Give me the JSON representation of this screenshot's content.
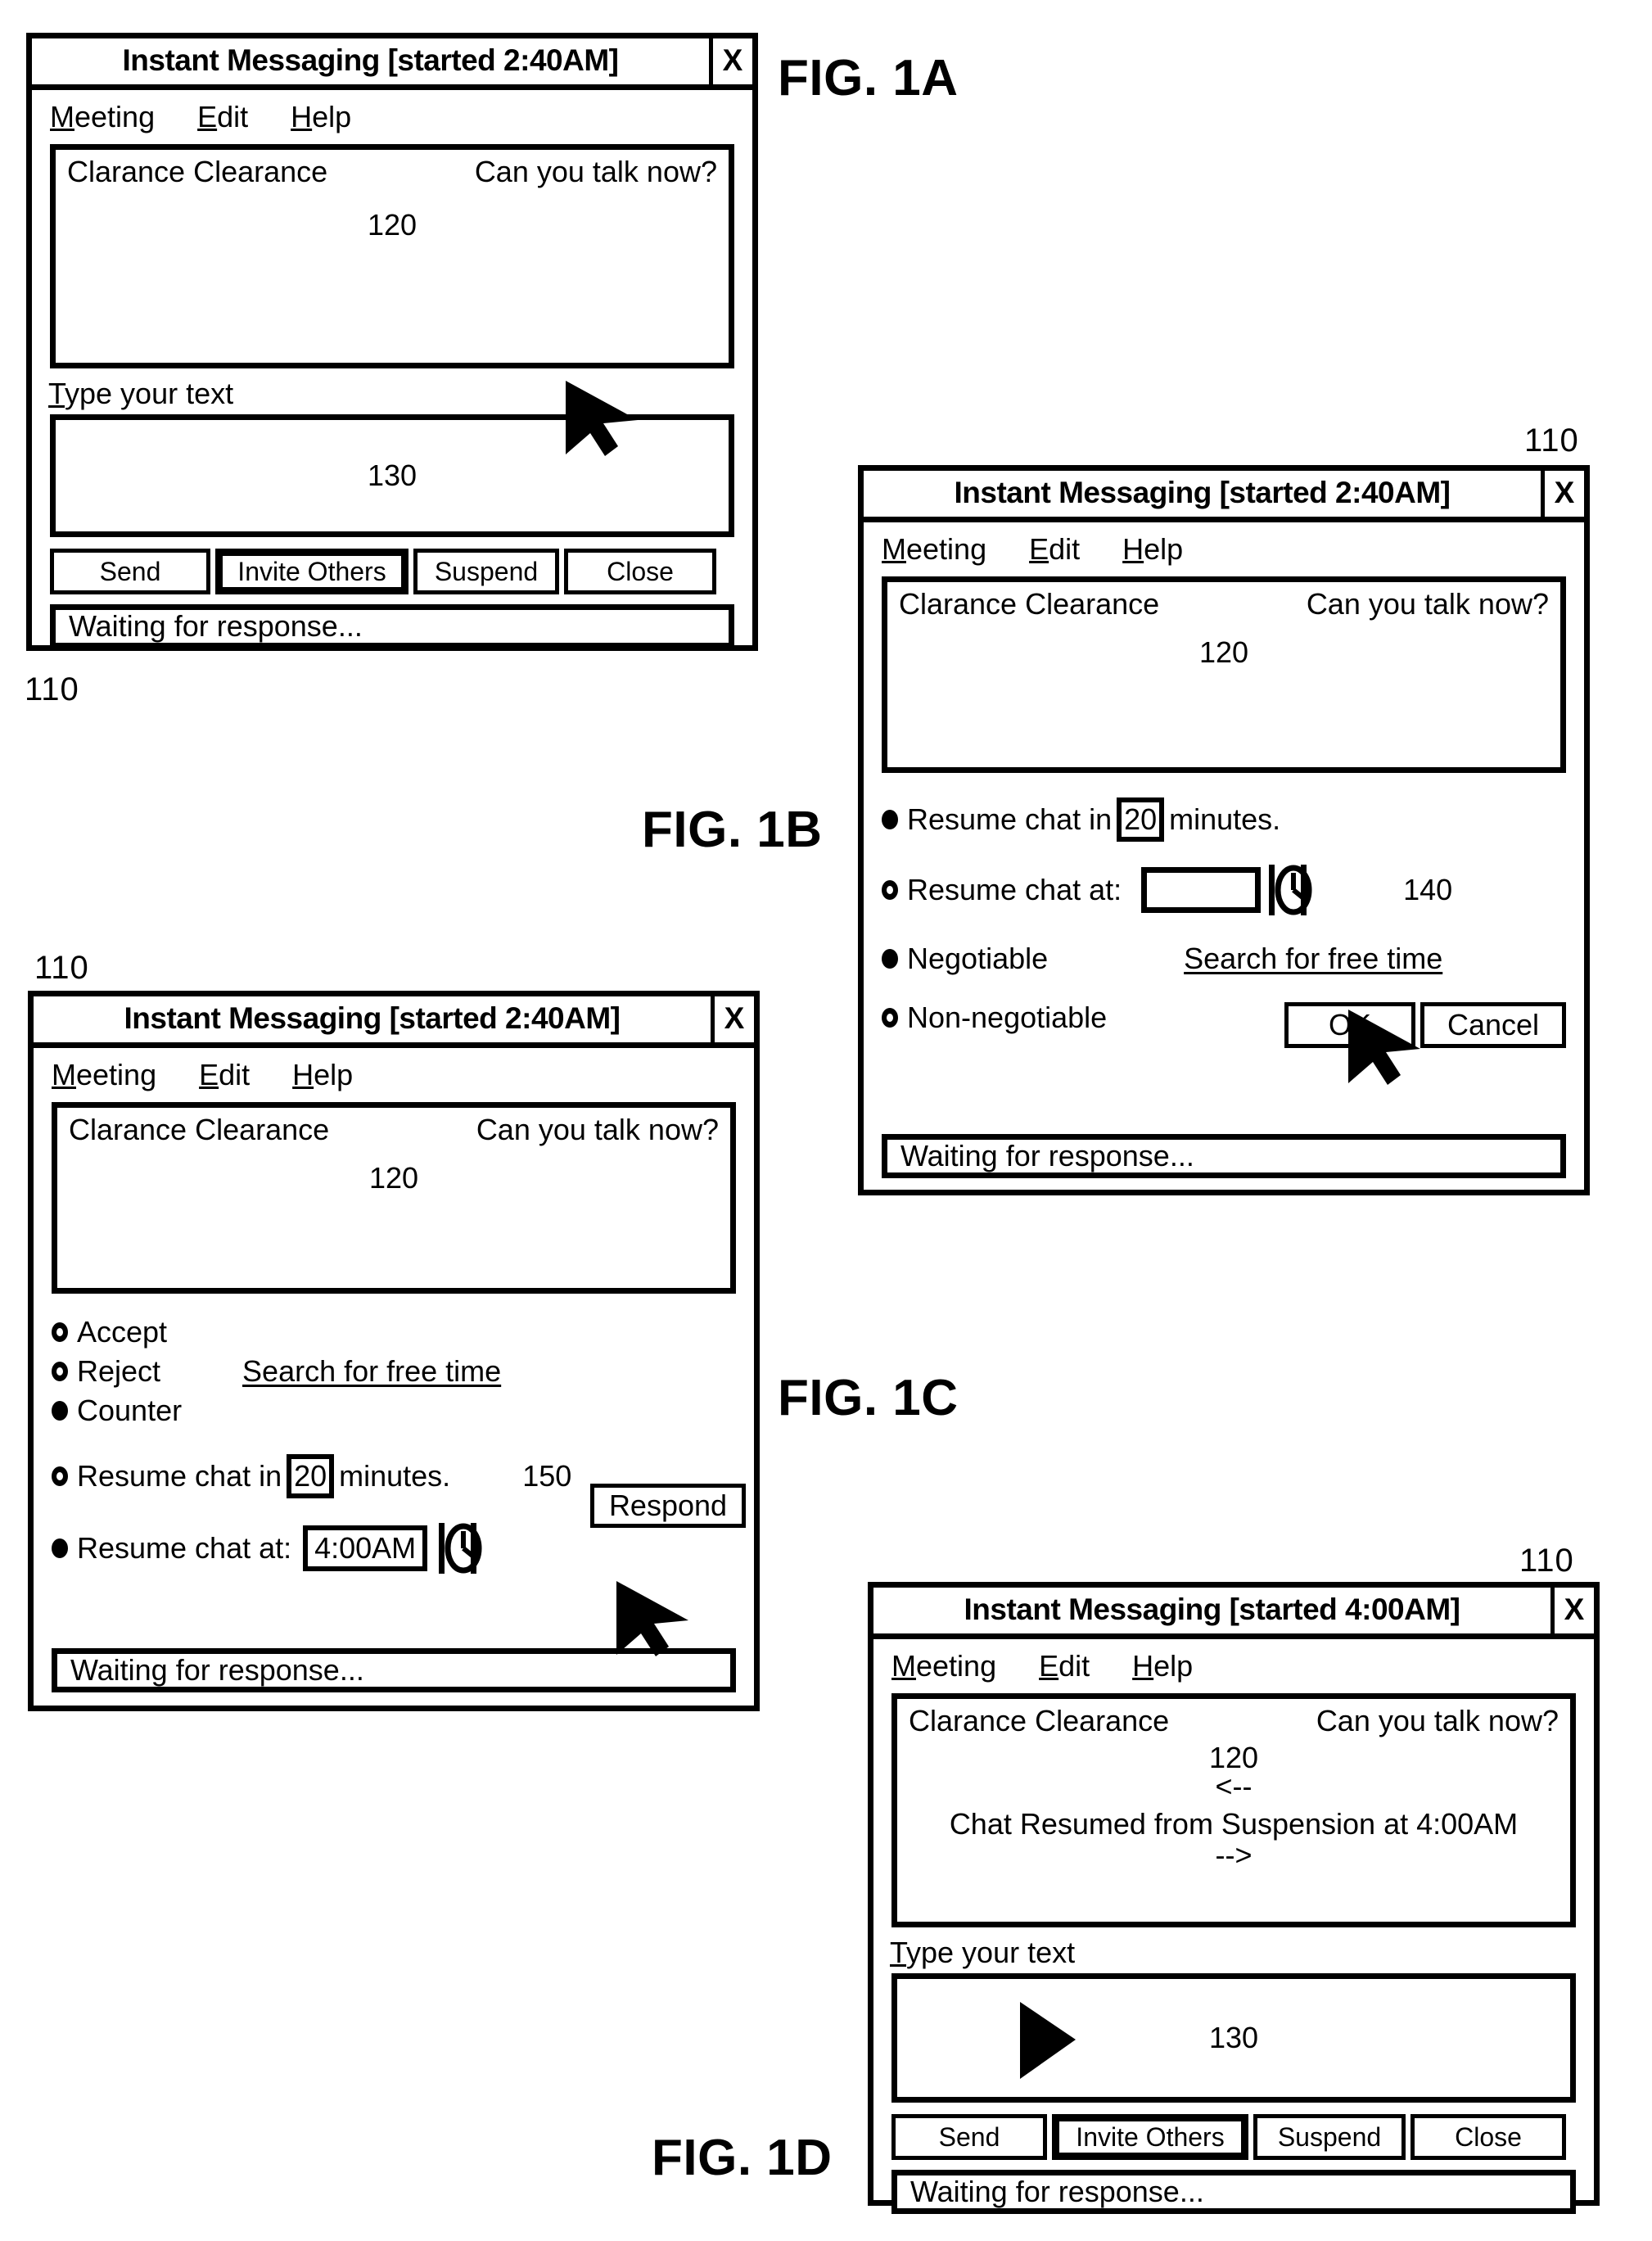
{
  "figures": {
    "fig_1a": {
      "label": "FIG. 1A",
      "ref": "110",
      "title": "Instant Messaging [started 2:40AM]",
      "close_label": "X",
      "menu": [
        "Meeting",
        "Edit",
        "Help"
      ],
      "chat": {
        "sender": "Clarance Clearance",
        "message": "Can you talk now?",
        "ref": "120"
      },
      "input_label": "Type your text",
      "input_ref": "130",
      "buttons": [
        "Send",
        "Invite Others",
        "Suspend",
        "Close"
      ],
      "status": "Waiting for response...",
      "cursor_on": "Suspend"
    },
    "fig_1b": {
      "label": "FIG. 1B",
      "ref": "110",
      "title": "Instant Messaging [started 2:40AM]",
      "close_label": "X",
      "menu": [
        "Meeting",
        "Edit",
        "Help"
      ],
      "chat": {
        "sender": "Clarance Clearance",
        "message": "Can you talk now?",
        "ref": "120"
      },
      "panel_ref": "140",
      "options": [
        {
          "selected": true,
          "text_before": "Resume chat in",
          "value": "20",
          "text_after": "minutes."
        },
        {
          "selected": false,
          "text_before": "Resume chat at:",
          "value": "",
          "text_after": ""
        },
        {
          "selected": true,
          "text_before": "Negotiable",
          "value": "",
          "text_after": ""
        },
        {
          "selected": false,
          "text_before": "Non-negotiable",
          "value": "",
          "text_after": ""
        }
      ],
      "search_link": "Search for free time",
      "buttons": [
        "OK",
        "Cancel"
      ],
      "status": "Waiting for response...",
      "cursor_on": "OK"
    },
    "fig_1c": {
      "label": "FIG. 1C",
      "ref": "110",
      "title": "Instant Messaging [started 2:40AM]",
      "close_label": "X",
      "menu": [
        "Meeting",
        "Edit",
        "Help"
      ],
      "chat": {
        "sender": "Clarance Clearance",
        "message": "Can you talk now?",
        "ref": "120"
      },
      "panel_ref": "150",
      "options": [
        {
          "selected": false,
          "text_before": "Accept",
          "value": "",
          "text_after": ""
        },
        {
          "selected": false,
          "text_before": "Reject",
          "value": "",
          "text_after": ""
        },
        {
          "selected": true,
          "text_before": "Counter",
          "value": "",
          "text_after": ""
        },
        {
          "selected": false,
          "text_before": "Resume chat in",
          "value": "20",
          "text_after": "minutes."
        },
        {
          "selected": true,
          "text_before": "Resume chat at:",
          "value": "4:00AM",
          "text_after": ""
        }
      ],
      "search_link": "Search for free time",
      "buttons": [
        "Respond"
      ],
      "status": "Waiting for response...",
      "cursor_on": "Respond"
    },
    "fig_1d": {
      "label": "FIG. 1D",
      "ref": "110",
      "title": "Instant Messaging [started 4:00AM]",
      "close_label": "X",
      "menu": [
        "Meeting",
        "Edit",
        "Help"
      ],
      "chat": {
        "sender": "Clarance Clearance",
        "message": "Can you talk now?",
        "ref": "120",
        "arrow_in": "<--",
        "resume_line": "Chat Resumed from Suspension at 4:00AM",
        "arrow_out": "-->"
      },
      "input_label": "Type your text",
      "input_ref": "130",
      "buttons": [
        "Send",
        "Invite Others",
        "Suspend",
        "Close"
      ],
      "focused_button": "Invite Others",
      "status": "Waiting for response...",
      "cursor_on": "text-input"
    }
  }
}
